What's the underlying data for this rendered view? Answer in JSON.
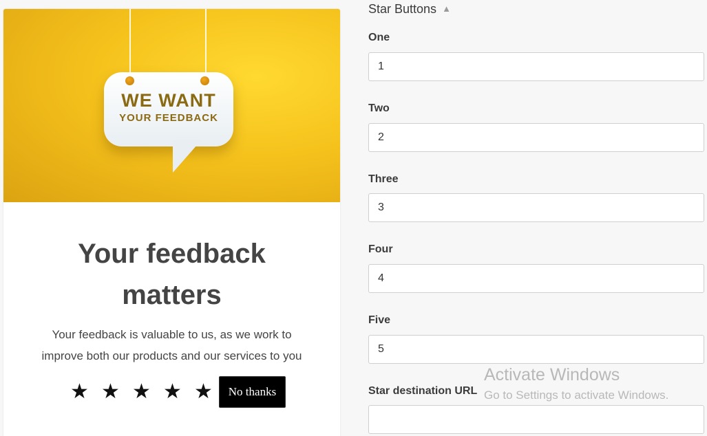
{
  "preview": {
    "hero": {
      "sign_title": "WE WANT",
      "sign_subtitle": "YOUR FEEDBACK"
    },
    "headline_line1": "Your feedback",
    "headline_line2": "matters",
    "description_line1": "Your feedback is valuable to us, as we work to",
    "description_line2": "improve both our products and our services to you",
    "stars": [
      "★",
      "★",
      "★",
      "★",
      "★"
    ],
    "no_thanks_label": "No thanks"
  },
  "panel": {
    "section_title": "Star Buttons",
    "fields": [
      {
        "label": "One",
        "value": "1"
      },
      {
        "label": "Two",
        "value": "2"
      },
      {
        "label": "Three",
        "value": "3"
      },
      {
        "label": "Four",
        "value": "4"
      },
      {
        "label": "Five",
        "value": "5"
      },
      {
        "label": "Star destination URL",
        "value": ""
      }
    ]
  },
  "watermark": {
    "title": "Activate Windows",
    "subtitle": "Go to Settings to activate Windows."
  },
  "colors": {
    "hero_yellow": "#f5c21c",
    "sign_text": "#8a6a12",
    "button_black": "#000000"
  }
}
